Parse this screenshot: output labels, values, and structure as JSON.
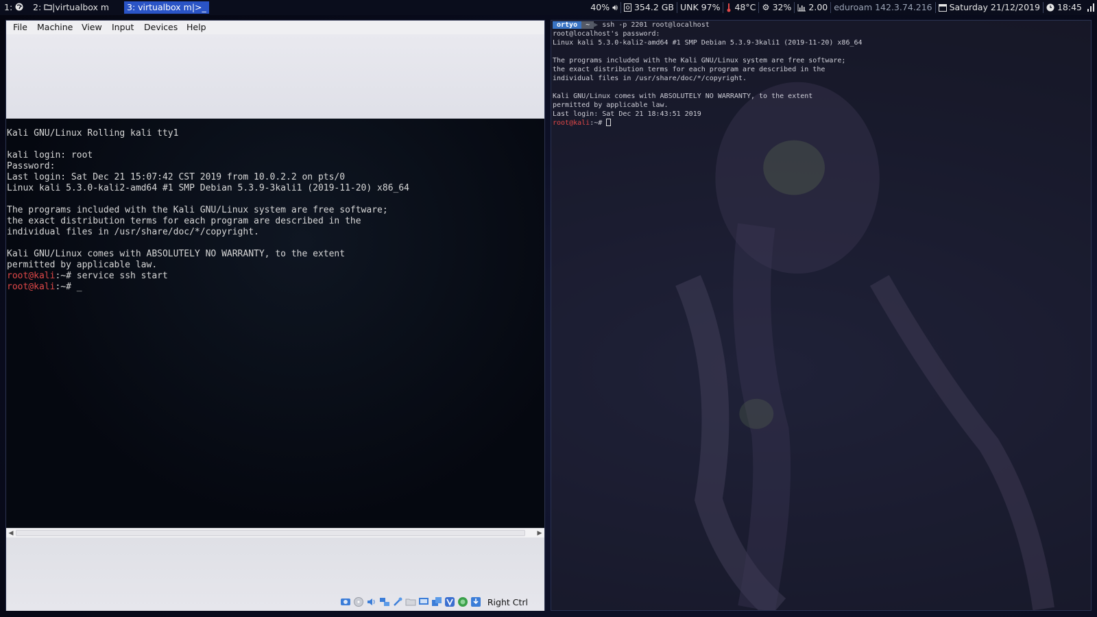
{
  "colors": {
    "topbar_bg": "#0a0d1c",
    "active_workspace": "#2a54c6",
    "prompt_red": "#e04848",
    "ps_user_bg": "#3a74c4"
  },
  "topbar": {
    "workspaces": [
      {
        "label": "1:",
        "icon": "kali-logo-icon",
        "active": false
      },
      {
        "label": "2:",
        "icon": "folder-icon",
        "title": "|virtualbox m",
        "active": false
      },
      {
        "label": "3: virtualbox m|>_",
        "active": true
      }
    ],
    "status": {
      "volume": "40%",
      "disk": "354.2 GB",
      "battery": "UNK 97%",
      "temperature": "48°C",
      "cpu": "32%",
      "load": "2.00",
      "network": "eduroam 142.3.74.216",
      "date": "Saturday 21/12/2019",
      "time": "18:45"
    }
  },
  "vbox": {
    "menu": [
      "File",
      "Machine",
      "View",
      "Input",
      "Devices",
      "Help"
    ],
    "tty": {
      "banner": "Kali GNU/Linux Rolling kali tty1",
      "login": "kali login: root",
      "password": "Password:",
      "last_login": "Last login: Sat Dec 21 15:07:42 CST 2019 from 10.0.2.2 on pts/0",
      "uname": "Linux kali 5.3.0-kali2-amd64 #1 SMP Debian 5.3.9-3kali1 (2019-11-20) x86_64",
      "motd1": "The programs included with the Kali GNU/Linux system are free software;",
      "motd2": "the exact distribution terms for each program are described in the",
      "motd3": "individual files in /usr/share/doc/*/copyright.",
      "motd4": "Kali GNU/Linux comes with ABSOLUTELY NO WARRANTY, to the extent",
      "motd5": "permitted by applicable law.",
      "prompt": "root@kali",
      "prompt_tail": ":~# ",
      "command1": "service ssh start",
      "cursor": "_"
    },
    "hostkey": "Right Ctrl",
    "status_icons": [
      "hard-disk-icon",
      "optical-drive-icon",
      "audio-icon",
      "network-icon",
      "usb-icon",
      "shared-folder-icon",
      "display-icon",
      "video-capture-icon",
      "virtualization-icon",
      "guest-additions-icon",
      "keyboard-capture-icon"
    ]
  },
  "terminal": {
    "ps_user": "ortyo",
    "ps_dir": "~",
    "command": "ssh -p 2201 root@localhost",
    "lines": [
      "root@localhost's password:",
      "Linux kali 5.3.0-kali2-amd64 #1 SMP Debian 5.3.9-3kali1 (2019-11-20) x86_64",
      "",
      "The programs included with the Kali GNU/Linux system are free software;",
      "the exact distribution terms for each program are described in the",
      "individual files in /usr/share/doc/*/copyright.",
      "",
      "Kali GNU/Linux comes with ABSOLUTELY NO WARRANTY, to the extent",
      "permitted by applicable law.",
      "Last login: Sat Dec 21 18:43:51 2019"
    ],
    "prompt": "root@kali",
    "prompt_tail": ":~# "
  }
}
